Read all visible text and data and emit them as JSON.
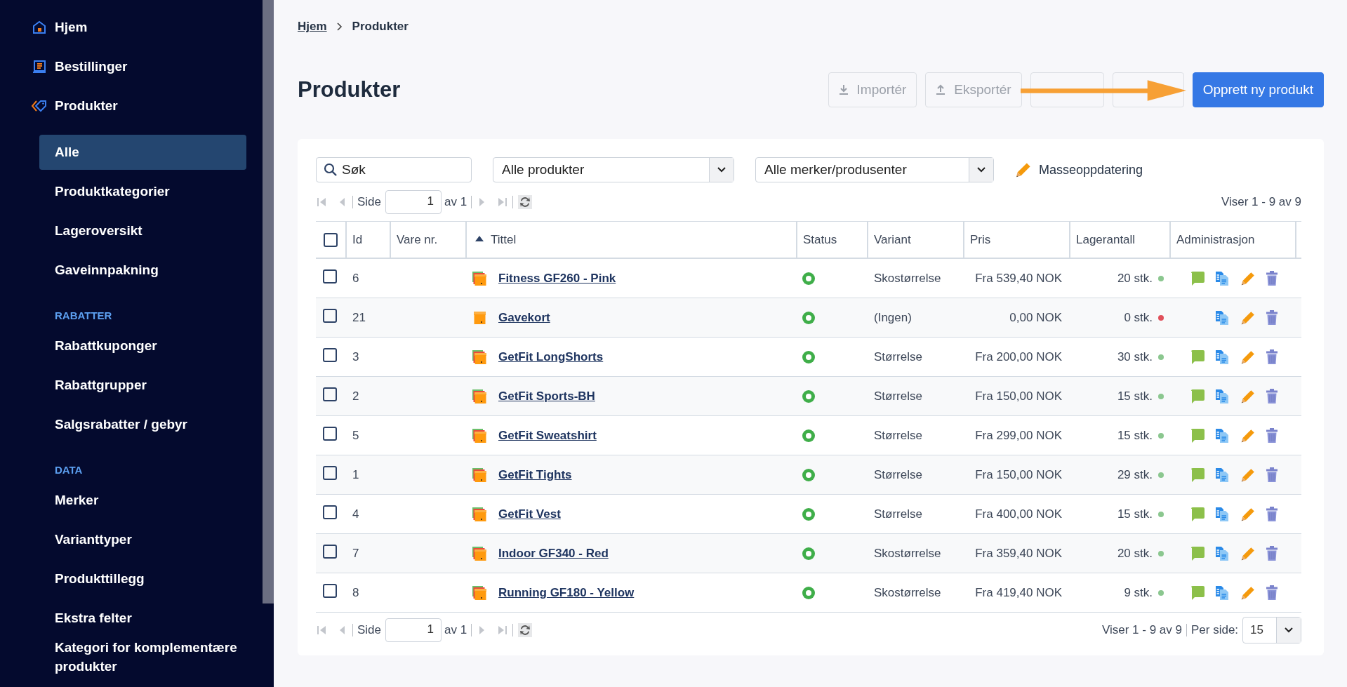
{
  "sidebar": {
    "items": [
      {
        "kind": "link",
        "label": "Hjem",
        "selected": false
      },
      {
        "kind": "link",
        "label": "Bestillinger",
        "selected": false
      },
      {
        "kind": "link",
        "label": "Produkter",
        "selected": false
      },
      {
        "kind": "sub",
        "label": "Alle",
        "selected": true
      },
      {
        "kind": "sub",
        "label": "Produktkategorier",
        "selected": false
      },
      {
        "kind": "sub",
        "label": "Lageroversikt",
        "selected": false
      },
      {
        "kind": "sub",
        "label": "Gaveinnpakning",
        "selected": false
      },
      {
        "kind": "heading",
        "label": "RABATTER"
      },
      {
        "kind": "sub",
        "label": "Rabattkuponger",
        "selected": false
      },
      {
        "kind": "sub",
        "label": "Rabattgrupper",
        "selected": false
      },
      {
        "kind": "sub",
        "label": "Salgsrabatter / gebyr",
        "selected": false
      },
      {
        "kind": "heading",
        "label": "DATA"
      },
      {
        "kind": "sub",
        "label": "Merker",
        "selected": false
      },
      {
        "kind": "sub",
        "label": "Varianttyper",
        "selected": false
      },
      {
        "kind": "sub",
        "label": "Produkttillegg",
        "selected": false
      },
      {
        "kind": "sub",
        "label": "Ekstra felter",
        "selected": false
      },
      {
        "kind": "sub",
        "label": "Kategori for komplementære produkter",
        "selected": false
      }
    ]
  },
  "breadcrumb": [
    {
      "label": "Hjem",
      "kind": "link"
    },
    {
      "label": "Produkter",
      "kind": "current"
    }
  ],
  "title": "Produkter",
  "actions": [
    {
      "label": "Importér",
      "disabled": true
    },
    {
      "label": "Eksportér",
      "disabled": true
    },
    {
      "disabled": true
    },
    {
      "disabled": true
    },
    {
      "label": "Opprett ny produkt",
      "disabled": false
    }
  ],
  "toolbar": {
    "search": {
      "value": "Søk"
    },
    "filters": [
      {
        "value": "Alle produkter"
      },
      {
        "value": "Alle merker/produsenter"
      }
    ],
    "bulk_update": "Masseoppdatering"
  },
  "pager_top": {
    "page_label": "Side",
    "page": "1",
    "of": "av 1",
    "summary": "Viser 1 - 9 av 9"
  },
  "table": {
    "all_checked": false,
    "columns": [
      {
        "label": "Id",
        "sorted": false
      },
      {
        "label": "Vare nr.",
        "sorted": false
      },
      {
        "label": "Tittel",
        "sorted": true
      },
      {
        "label": "Status",
        "sorted": false
      },
      {
        "label": "Variant",
        "sorted": false
      },
      {
        "label": "Pris",
        "sorted": false
      },
      {
        "label": "Lagerantall",
        "sorted": false
      },
      {
        "label": "Administrasjon",
        "sorted": false
      }
    ],
    "rows": [
      {
        "checked": false,
        "id": "6",
        "kind": "variants",
        "title": "Fitness GF260 - Pink",
        "active": true,
        "variant": "Skostørrelse",
        "price": "Fra 539,40 NOK",
        "stock": "20 stk.",
        "color": "#8bc78f",
        "comment": true
      },
      {
        "checked": false,
        "id": "21",
        "kind": "single",
        "title": "Gavekort",
        "active": true,
        "variant": "(Ingen)",
        "price": "0,00 NOK",
        "stock": "0 stk.",
        "color": "#e0505a",
        "comment": false
      },
      {
        "checked": false,
        "id": "3",
        "kind": "variants",
        "title": "GetFit LongShorts",
        "active": true,
        "variant": "Størrelse",
        "price": "Fra 200,00 NOK",
        "stock": "30 stk.",
        "color": "#8bc78f",
        "comment": true
      },
      {
        "checked": false,
        "id": "2",
        "kind": "variants",
        "title": "GetFit Sports-BH",
        "active": true,
        "variant": "Størrelse",
        "price": "Fra 150,00 NOK",
        "stock": "15 stk.",
        "color": "#8bc78f",
        "comment": true
      },
      {
        "checked": false,
        "id": "5",
        "kind": "variants",
        "title": "GetFit Sweatshirt",
        "active": true,
        "variant": "Størrelse",
        "price": "Fra 299,00 NOK",
        "stock": "15 stk.",
        "color": "#8bc78f",
        "comment": true
      },
      {
        "checked": false,
        "id": "1",
        "kind": "variants",
        "title": "GetFit Tights",
        "active": true,
        "variant": "Størrelse",
        "price": "Fra 150,00 NOK",
        "stock": "29 stk.",
        "color": "#8bc78f",
        "comment": true
      },
      {
        "checked": false,
        "id": "4",
        "kind": "variants",
        "title": "GetFit Vest",
        "active": true,
        "variant": "Størrelse",
        "price": "Fra 400,00 NOK",
        "stock": "15 stk.",
        "color": "#8bc78f",
        "comment": true
      },
      {
        "checked": false,
        "id": "7",
        "kind": "variants",
        "title": "Indoor GF340 - Red",
        "active": true,
        "variant": "Skostørrelse",
        "price": "Fra 359,40 NOK",
        "stock": "20 stk.",
        "color": "#8bc78f",
        "comment": true
      },
      {
        "checked": false,
        "id": "8",
        "kind": "variants",
        "title": "Running GF180 - Yellow",
        "active": true,
        "variant": "Skostørrelse",
        "price": "Fra 419,40 NOK",
        "stock": "9 stk.",
        "color": "#8bc78f",
        "comment": true
      }
    ]
  },
  "pager_bottom": {
    "page_label": "Side",
    "page": "1",
    "of": "av 1",
    "summary": "Viser 1 - 9 av 9",
    "per_page_label": "Per side:",
    "per_page": "15"
  }
}
